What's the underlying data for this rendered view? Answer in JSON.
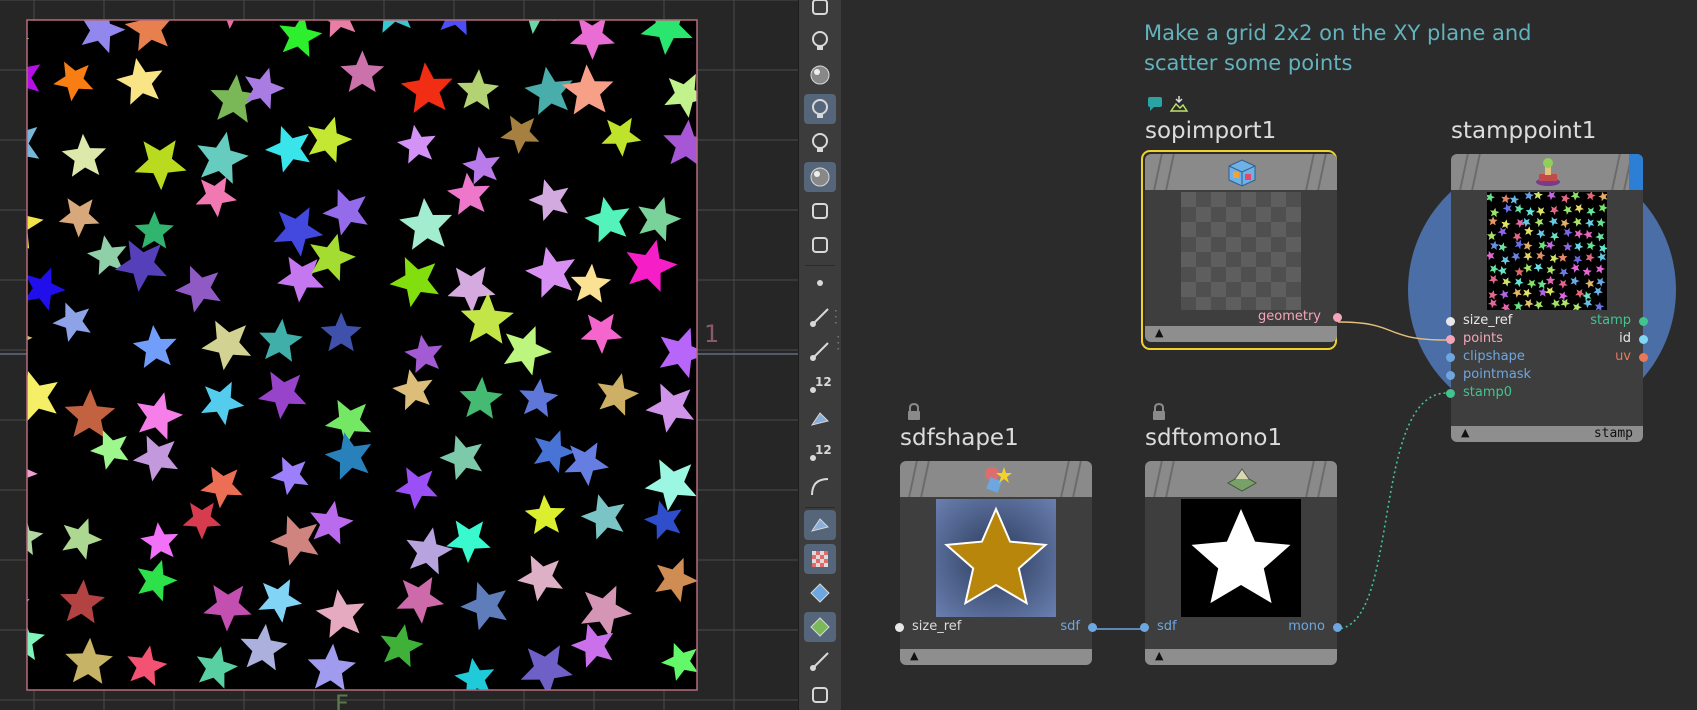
{
  "viewport": {
    "label_right": "1",
    "label_bottom": "F"
  },
  "toolbar": {
    "tools": [
      "new-object-icon",
      "light-bulb-icon",
      "display-options-icon",
      "lighting-icon",
      "headlight-icon",
      "shading-icon",
      "show-guides-icon",
      "camera-view-icon",
      "point-display-icon",
      "brush-icon",
      "dropper-icon",
      "point-numbers-icon",
      "paint-icon",
      "primitive-numbers-icon",
      "curve-icon",
      "uv-display-icon",
      "checker-icon",
      "geometry-display-icon",
      "stamp-display-icon",
      "pin-icon",
      "layer-icon"
    ],
    "label_12a": "12",
    "label_12b": "12"
  },
  "network": {
    "sticky_note": "Make a grid 2x2 on the XY plane and scatter some points",
    "nodes": {
      "sopimport": {
        "title": "sopimport1",
        "outputs": [
          "geometry"
        ]
      },
      "stamppoint": {
        "title": "stamppoint1",
        "inputs": [
          "size_ref",
          "points",
          "clipshape",
          "pointmask",
          "stamp0"
        ],
        "outputs": [
          "stamp",
          "id",
          "uv"
        ],
        "footer": "stamp"
      },
      "sdfshape": {
        "title": "sdfshape1",
        "inputs": [
          "size_ref"
        ],
        "outputs": [
          "sdf"
        ]
      },
      "sdftomono": {
        "title": "sdftomono1",
        "inputs": [
          "sdf"
        ],
        "outputs": [
          "mono"
        ]
      }
    },
    "colors": {
      "selected_outline": "#f2d12e",
      "port_white": "#e8e8e8",
      "port_pink": "#f4a6b8",
      "port_blue": "#6ea7e0",
      "port_green": "#41c48f",
      "port_orange": "#e8785a",
      "port_cyan": "#7fd6f5"
    }
  }
}
